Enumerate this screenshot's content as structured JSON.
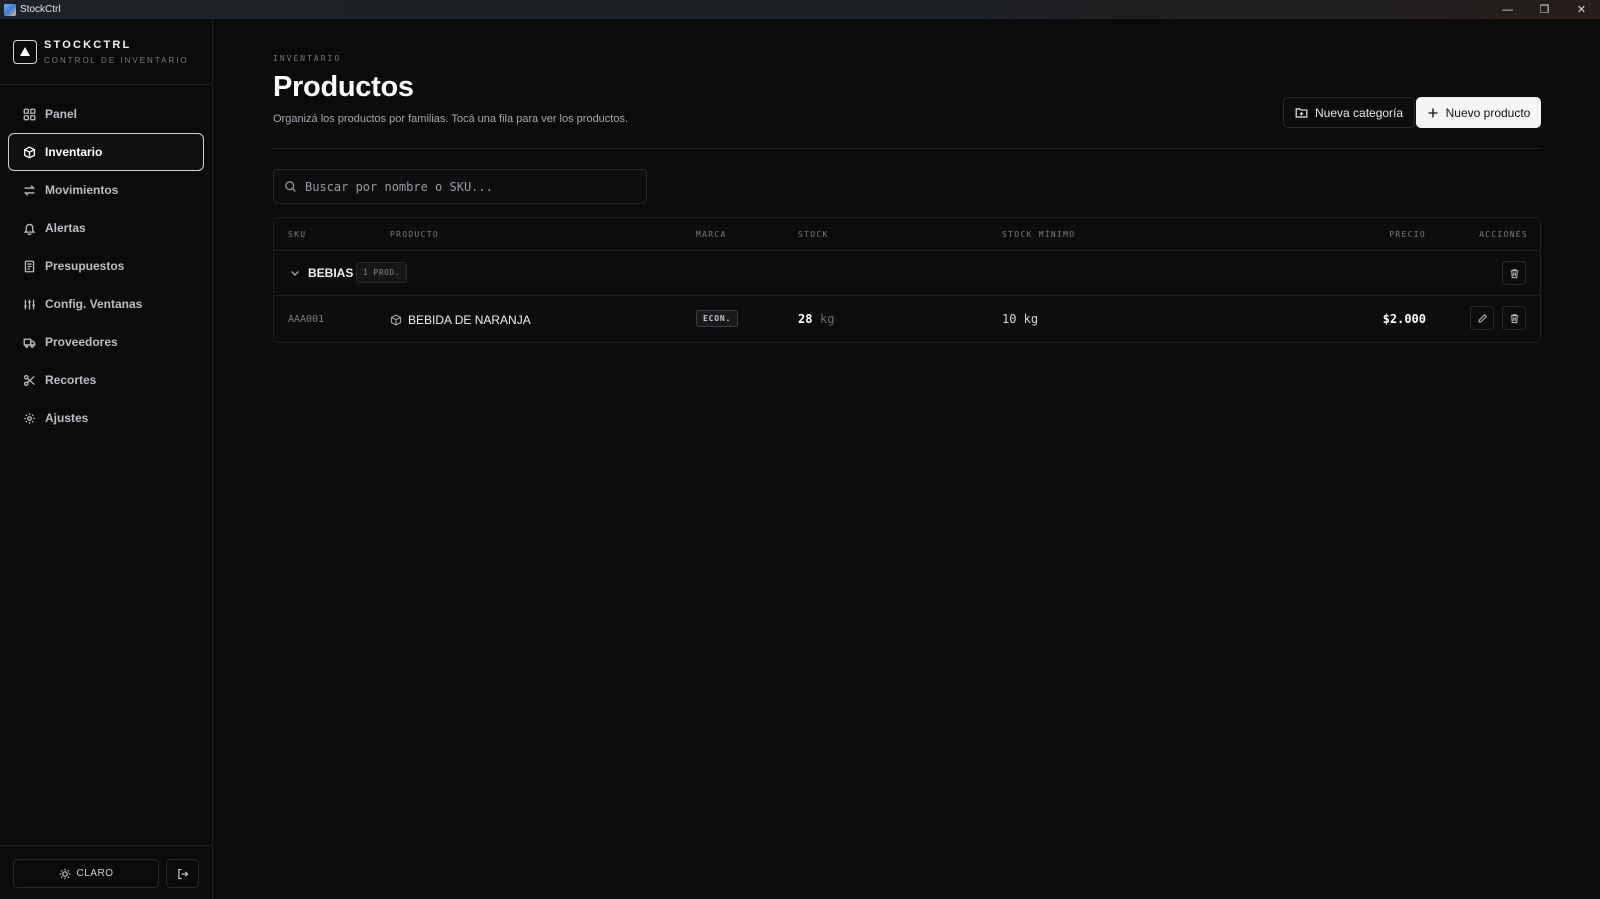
{
  "window": {
    "title": "StockCtrl",
    "minimize": "—",
    "restore": "❐",
    "close": "✕"
  },
  "brand": {
    "name": "STOCKCTRL",
    "subtitle": "CONTROL DE INVENTARIO"
  },
  "nav": [
    {
      "label": "Panel",
      "icon": "grid-icon"
    },
    {
      "label": "Inventario",
      "icon": "box-icon",
      "active": true
    },
    {
      "label": "Movimientos",
      "icon": "arrows-icon"
    },
    {
      "label": "Alertas",
      "icon": "bell-icon"
    },
    {
      "label": "Presupuestos",
      "icon": "receipt-icon"
    },
    {
      "label": "Config. Ventanas",
      "icon": "sliders-icon"
    },
    {
      "label": "Proveedores",
      "icon": "truck-icon"
    },
    {
      "label": "Recortes",
      "icon": "scissors-icon"
    },
    {
      "label": "Ajustes",
      "icon": "gear-icon"
    }
  ],
  "footer": {
    "theme_label": "CLARO"
  },
  "header": {
    "eyebrow": "INVENTARIO",
    "title": "Productos",
    "description": "Organizá los productos por familias. Tocá una fila para ver los productos.",
    "new_category": "Nueva categoría",
    "new_product": "Nuevo producto"
  },
  "search": {
    "placeholder": "Buscar por nombre o SKU...",
    "value": ""
  },
  "table": {
    "columns": {
      "sku": "SKU",
      "product": "PRODUCTO",
      "brand": "MARCA",
      "stock": "STOCK",
      "min_stock": "STOCK MÍNIMO",
      "price": "PRECIO",
      "actions": "ACCIONES"
    },
    "groups": [
      {
        "name": "BEBIAS",
        "count": "1 PROD.",
        "products": [
          {
            "sku": "AAA001",
            "name": "BEBIDA DE NARANJA",
            "brand": "ECON.",
            "stock": "28",
            "stock_unit": "kg",
            "min_stock": "10 kg",
            "price": "$2.000"
          }
        ]
      }
    ]
  },
  "colors": {
    "background": "#0b0b0c",
    "primary_button": "#f5f5f6",
    "border": "#2a2a2e"
  }
}
